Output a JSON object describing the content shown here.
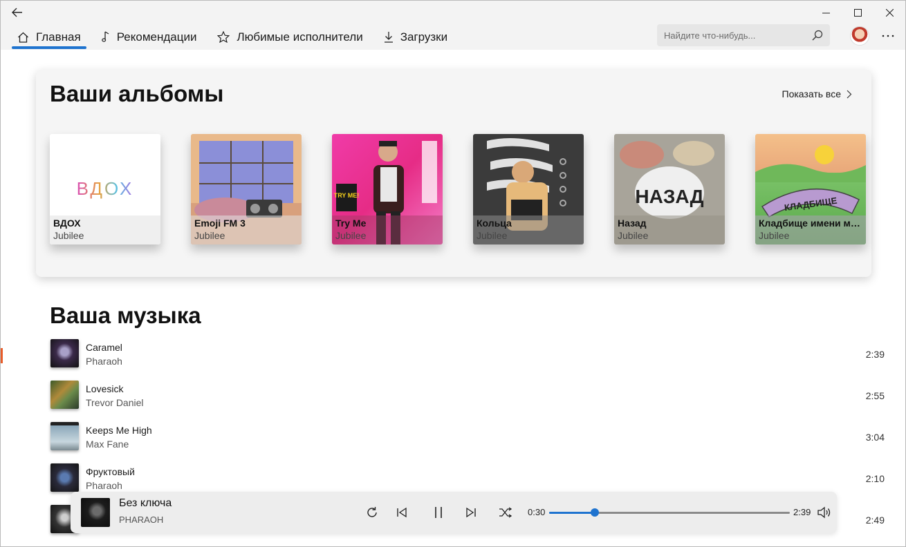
{
  "nav": {
    "tabs": [
      {
        "label": "Главная",
        "icon": "home-icon"
      },
      {
        "label": "Рекомендации",
        "icon": "music-note-icon"
      },
      {
        "label": "Любимые исполнители",
        "icon": "star-icon"
      },
      {
        "label": "Загрузки",
        "icon": "download-icon"
      }
    ],
    "search_placeholder": "Найдите что-нибудь..."
  },
  "albums": {
    "title": "Ваши альбомы",
    "show_all": "Показать все",
    "items": [
      {
        "name": "ВДОХ",
        "artist": "Jubilee",
        "art_text": "ВДОХ"
      },
      {
        "name": "Emoji FM 3",
        "artist": "Jubilee"
      },
      {
        "name": "Try Me",
        "artist": "Jubilee",
        "art_text": "TRY ME!"
      },
      {
        "name": "Кольца",
        "artist": "Jubilee"
      },
      {
        "name": "Назад",
        "artist": "Jubilee",
        "art_text": "НАЗАД"
      },
      {
        "name": "Кладбище имени меня",
        "artist": "Jubilee",
        "art_text": "КЛАДБИЩЕ"
      }
    ]
  },
  "music": {
    "title": "Ваша музыка",
    "tracks": [
      {
        "title": "Caramel",
        "artist": "Pharaoh",
        "duration": "2:39"
      },
      {
        "title": "Lovesick",
        "artist": "Trevor Daniel",
        "duration": "2:55"
      },
      {
        "title": "Keeps Me High",
        "artist": "Max Fane",
        "duration": "3:04"
      },
      {
        "title": "Фруктовый",
        "artist": "Pharaoh",
        "duration": "2:10"
      },
      {
        "title": "",
        "artist": "",
        "duration": "2:49"
      }
    ]
  },
  "player": {
    "title": "Без ключа",
    "artist": "PHARAOH",
    "current_time": "0:30",
    "total_time": "2:39",
    "progress": 0.19
  },
  "colors": {
    "accent": "#1e73cf",
    "chrome_bg": "#f3f3f3"
  }
}
